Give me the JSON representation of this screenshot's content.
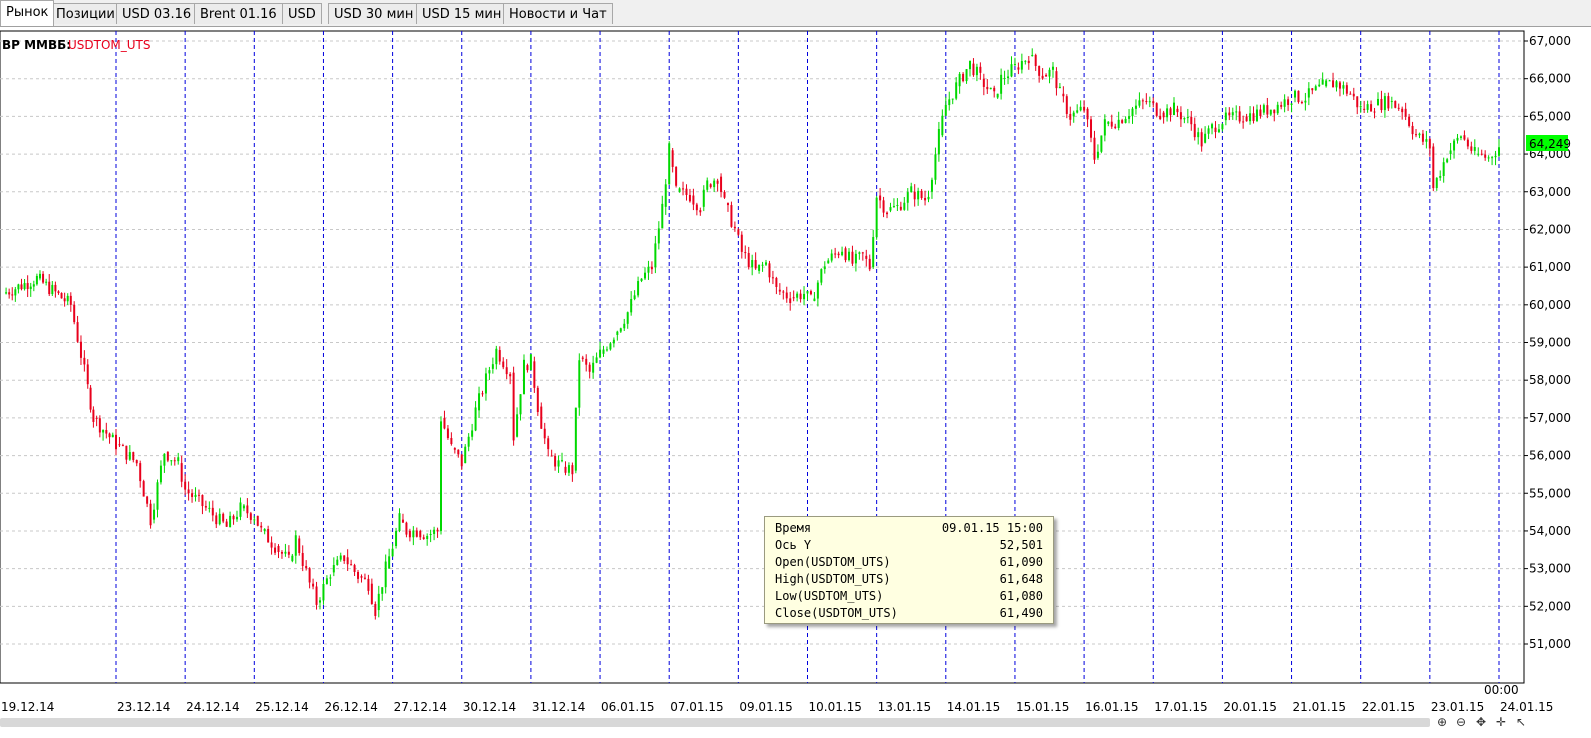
{
  "tabs": [
    {
      "label": "Рынок",
      "active": true
    },
    {
      "label": "Позиции",
      "active": false
    },
    {
      "label": "USD 03.16",
      "active": false
    },
    {
      "label": "Brent  01.16",
      "active": false
    },
    {
      "label": "USD",
      "active": false
    },
    {
      "label": "USD 30 мин",
      "active": false
    },
    {
      "label": "USD 15 мин",
      "active": false
    },
    {
      "label": "Новости и Чат",
      "active": false
    }
  ],
  "chart": {
    "exchange": "BP ММВБ:",
    "instrument": "USDTOM_UTS",
    "current_price_label": "64,249",
    "time_readout": "00:00",
    "colors": {
      "up": "#00d800",
      "down": "#e8001c",
      "grid": "#c8c8c8",
      "separator": "#0000dd",
      "price_badge": "#00ff00"
    }
  },
  "chart_data": {
    "type": "candlestick",
    "symbol": "USDTOM_UTS",
    "ylim": [
      51000,
      67000
    ],
    "y_ticks": [
      "67,000",
      "66,000",
      "65,000",
      "64,000",
      "63,000",
      "62,000",
      "61,000",
      "60,000",
      "59,000",
      "58,000",
      "57,000",
      "56,000",
      "55,000",
      "54,000",
      "53,000",
      "52,000",
      "51,000"
    ],
    "x_ticks": [
      "19.12.14",
      "23.12.14",
      "24.12.14",
      "25.12.14",
      "26.12.14",
      "27.12.14",
      "30.12.14",
      "31.12.14",
      "06.01.15",
      "07.01.15",
      "09.01.15",
      "10.01.15",
      "13.01.15",
      "14.01.15",
      "15.01.15",
      "16.01.15",
      "17.01.15",
      "20.01.15",
      "21.01.15",
      "22.01.15",
      "23.01.15",
      "24.01.15"
    ],
    "close_path": [
      [
        0,
        60300
      ],
      [
        0.3,
        60700
      ],
      [
        0.6,
        60000
      ],
      [
        0.75,
        57800
      ],
      [
        0.8,
        57000
      ],
      [
        1.0,
        56300
      ],
      [
        1.3,
        55800
      ],
      [
        1.5,
        54300
      ],
      [
        1.7,
        56100
      ],
      [
        1.9,
        55800
      ],
      [
        2.0,
        55100
      ],
      [
        2.3,
        54600
      ],
      [
        2.6,
        54100
      ],
      [
        2.8,
        54600
      ],
      [
        3.0,
        54400
      ],
      [
        3.1,
        54000
      ],
      [
        3.3,
        53600
      ],
      [
        3.5,
        53200
      ],
      [
        3.6,
        53800
      ],
      [
        3.8,
        52600
      ],
      [
        3.9,
        52100
      ],
      [
        4.1,
        52900
      ],
      [
        4.3,
        53300
      ],
      [
        4.5,
        52800
      ],
      [
        4.65,
        52600
      ],
      [
        4.75,
        51900
      ],
      [
        4.9,
        53000
      ],
      [
        5.0,
        53600
      ],
      [
        5.1,
        54300
      ],
      [
        5.2,
        54000
      ],
      [
        5.35,
        54000
      ],
      [
        5.5,
        53900
      ],
      [
        5.65,
        54000
      ],
      [
        5.7,
        57000
      ],
      [
        5.85,
        56200
      ],
      [
        6.0,
        55800
      ],
      [
        6.2,
        57200
      ],
      [
        6.4,
        58300
      ],
      [
        6.5,
        58800
      ],
      [
        6.7,
        58200
      ],
      [
        6.75,
        56500
      ],
      [
        6.9,
        58400
      ],
      [
        7.0,
        58500
      ],
      [
        7.1,
        57300
      ],
      [
        7.25,
        56000
      ],
      [
        7.45,
        55700
      ],
      [
        7.6,
        55600
      ],
      [
        7.7,
        58600
      ],
      [
        7.85,
        58200
      ],
      [
        8.0,
        58700
      ],
      [
        8.2,
        59200
      ],
      [
        8.4,
        59800
      ],
      [
        8.6,
        60700
      ],
      [
        8.75,
        61000
      ],
      [
        8.9,
        62600
      ],
      [
        9.0,
        64100
      ],
      [
        9.1,
        63000
      ],
      [
        9.3,
        62900
      ],
      [
        9.45,
        62600
      ],
      [
        9.55,
        63200
      ],
      [
        9.7,
        63400
      ],
      [
        9.8,
        62700
      ],
      [
        9.95,
        62000
      ],
      [
        10.05,
        61400
      ],
      [
        10.25,
        60900
      ],
      [
        10.4,
        61100
      ],
      [
        10.55,
        60400
      ],
      [
        10.75,
        60200
      ],
      [
        10.95,
        60300
      ],
      [
        11.05,
        60100
      ],
      [
        11.25,
        61100
      ],
      [
        11.5,
        61500
      ],
      [
        11.65,
        61100
      ],
      [
        11.8,
        61300
      ],
      [
        11.9,
        61000
      ],
      [
        12.0,
        62900
      ],
      [
        12.15,
        62500
      ],
      [
        12.3,
        62600
      ],
      [
        12.5,
        63000
      ],
      [
        12.7,
        62800
      ],
      [
        12.75,
        63000
      ],
      [
        12.9,
        64500
      ],
      [
        13.0,
        65300
      ],
      [
        13.15,
        65800
      ],
      [
        13.35,
        66400
      ],
      [
        13.5,
        66000
      ],
      [
        13.7,
        65500
      ],
      [
        13.8,
        66000
      ],
      [
        14.0,
        66300
      ],
      [
        14.2,
        66600
      ],
      [
        14.4,
        66100
      ],
      [
        14.55,
        66200
      ],
      [
        14.65,
        65600
      ],
      [
        14.8,
        65000
      ],
      [
        15.0,
        65200
      ],
      [
        15.15,
        63900
      ],
      [
        15.3,
        64800
      ],
      [
        15.5,
        64900
      ],
      [
        15.7,
        65200
      ],
      [
        15.9,
        65400
      ],
      [
        16.1,
        65100
      ],
      [
        16.3,
        65200
      ],
      [
        16.55,
        64800
      ],
      [
        16.7,
        64300
      ],
      [
        16.85,
        64700
      ],
      [
        17.0,
        64900
      ],
      [
        17.3,
        65000
      ],
      [
        17.55,
        65100
      ],
      [
        17.8,
        65300
      ],
      [
        18.0,
        65500
      ],
      [
        18.2,
        65500
      ],
      [
        18.45,
        65800
      ],
      [
        18.65,
        65900
      ],
      [
        18.85,
        65600
      ],
      [
        19.0,
        65200
      ],
      [
        19.2,
        65300
      ],
      [
        19.4,
        65400
      ],
      [
        19.6,
        65200
      ],
      [
        19.8,
        64500
      ],
      [
        20.0,
        64200
      ],
      [
        20.05,
        63100
      ],
      [
        20.25,
        64000
      ],
      [
        20.45,
        64500
      ],
      [
        20.65,
        64000
      ],
      [
        20.85,
        63900
      ],
      [
        21.0,
        64200
      ]
    ],
    "hover": {
      "time": "09.01.15 15:00",
      "axis_y": "52,501",
      "open": "61,090",
      "high": "61,648",
      "low": "61,080",
      "close": "61,490"
    }
  },
  "tooltip": {
    "rows": [
      {
        "label": "Время",
        "value": "09.01.15 15:00"
      },
      {
        "label": "Ось Y",
        "value": "52,501"
      },
      {
        "label": "Open(USDTOM_UTS)",
        "value": "61,090"
      },
      {
        "label": "High(USDTOM_UTS)",
        "value": "61,648"
      },
      {
        "label": "Low(USDTOM_UTS)",
        "value": "61,080"
      },
      {
        "label": "Close(USDTOM_UTS)",
        "value": "61,490"
      }
    ]
  },
  "scrollbar": {
    "icons": [
      "zoom-in-icon",
      "zoom-out-icon",
      "move-icon",
      "crosshair-icon",
      "cursor-icon"
    ]
  }
}
